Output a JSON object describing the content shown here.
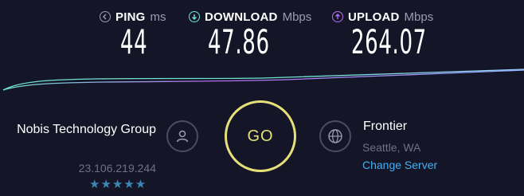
{
  "metrics": {
    "ping": {
      "label": "PING",
      "unit": "ms",
      "value": "44",
      "icon": "ping-icon"
    },
    "download": {
      "label": "DOWNLOAD",
      "unit": "Mbps",
      "value": "47.86",
      "icon": "download-arrow-icon"
    },
    "upload": {
      "label": "UPLOAD",
      "unit": "Mbps",
      "value": "264.07",
      "icon": "upload-arrow-icon"
    }
  },
  "colors": {
    "background": "#141526",
    "download_accent": "#6fe3d2",
    "upload_accent": "#b46ff0",
    "go_accent": "#e6e07a",
    "link": "#45b0f2",
    "star": "#3b86b5"
  },
  "provider": {
    "name": "Nobis Technology Group",
    "ip": "23.106.219.244",
    "rating": 5,
    "rating_stars": "★★★★★",
    "icon": "user-icon"
  },
  "go_button": {
    "label": "GO"
  },
  "server": {
    "name": "Frontier",
    "location": "Seattle, WA",
    "change_label": "Change Server",
    "icon": "globe-icon"
  }
}
